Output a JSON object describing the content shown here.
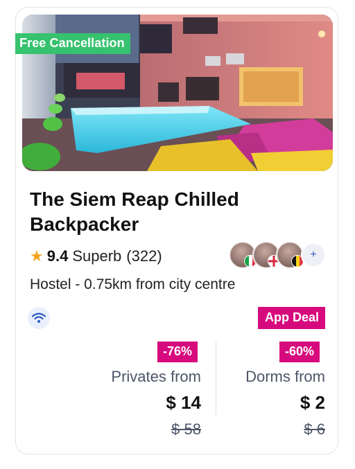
{
  "listing": {
    "badge_free": "Free Cancellation",
    "title": "The Siem Reap Chilled Backpacker",
    "rating": {
      "score": "9.4",
      "word": "Superb",
      "count": "(322)"
    },
    "reviewers": {
      "flags": [
        "italy",
        "england",
        "belgium"
      ],
      "more": "+"
    },
    "description": "Hostel - 0.75km from city centre",
    "amenity_icon": "wifi-icon",
    "deal_badge": "App Deal",
    "photo_carousel": {
      "count": 4,
      "active_index": 0
    },
    "privates": {
      "discount": "-76%",
      "label": "Privates from",
      "price": "$ 14",
      "old_price": "$ 58"
    },
    "dorms": {
      "discount": "-60%",
      "label": "Dorms from",
      "price": "$ 2",
      "old_price": "$ 6"
    }
  },
  "colors": {
    "accent_pink": "#d60a7d",
    "free_green": "#36c26e",
    "star": "#f4a21a",
    "link_blue": "#2b59c3"
  }
}
